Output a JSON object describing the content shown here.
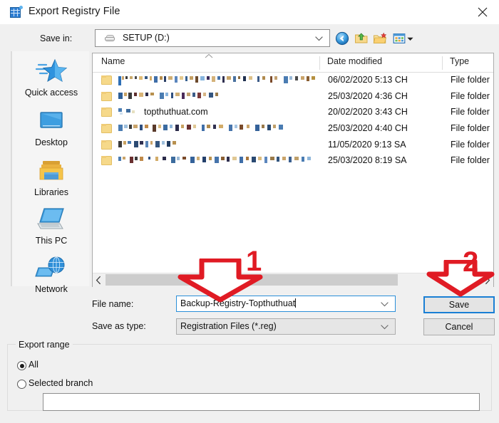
{
  "window": {
    "title": "Export Registry File",
    "icon": "registry-editor-icon",
    "close_label": "✕"
  },
  "toolbar": {
    "save_in_label": "Save in:",
    "save_in_value": "SETUP (D:)",
    "buttons": [
      {
        "name": "back-button",
        "icon": "back-arrow-icon",
        "label": "Back"
      },
      {
        "name": "up-one-level-button",
        "icon": "up-folder-icon",
        "label": "Up One Level"
      },
      {
        "name": "create-new-folder-button",
        "icon": "new-folder-icon",
        "label": "Create New Folder"
      },
      {
        "name": "views-button",
        "icon": "views-icon",
        "label": "Views"
      }
    ]
  },
  "places": {
    "items": [
      {
        "label": "Quick access",
        "icon": "quick-access-star-icon"
      },
      {
        "label": "Desktop",
        "icon": "desktop-monitor-icon"
      },
      {
        "label": "Libraries",
        "icon": "libraries-folder-icon"
      },
      {
        "label": "This PC",
        "icon": "this-pc-computer-icon"
      },
      {
        "label": "Network",
        "icon": "network-globe-icon"
      }
    ]
  },
  "file_list": {
    "columns": [
      "Name",
      "Date modified",
      "Type"
    ],
    "sort_column": "Name",
    "sort_direction": "ascending",
    "rows": [
      {
        "name": "",
        "name_redacted": true,
        "date_modified": "06/02/2020 5:13 CH",
        "type": "File folder"
      },
      {
        "name": "",
        "name_redacted": true,
        "date_modified": "25/03/2020 4:36 CH",
        "type": "File folder"
      },
      {
        "name": "topthuthuat.com",
        "name_redacted": false,
        "date_modified": "20/02/2020 3:43 CH",
        "type": "File folder"
      },
      {
        "name": "",
        "name_redacted": true,
        "date_modified": "25/03/2020 4:40 CH",
        "type": "File folder"
      },
      {
        "name": "",
        "name_redacted": true,
        "date_modified": "11/05/2020 9:13 SA",
        "type": "File folder"
      },
      {
        "name": "",
        "name_redacted": true,
        "date_modified": "25/03/2020 8:19 SA",
        "type": "File folder"
      }
    ]
  },
  "form": {
    "file_name_label": "File name:",
    "file_name_value": "Backup-Registry-Topthuthuat",
    "save_as_type_label": "Save as type:",
    "save_as_type_value": "Registration Files (*.reg)",
    "save_button": "Save",
    "cancel_button": "Cancel"
  },
  "export_range": {
    "group_title": "Export range",
    "options": [
      {
        "label": "All",
        "selected": true
      },
      {
        "label": "Selected branch",
        "selected": false
      }
    ],
    "branch_value": ""
  },
  "annotations": {
    "step_one": "1",
    "step_two": "2"
  },
  "colors": {
    "accent_blue": "#1a7fd4",
    "annotation_red": "#e01b24",
    "dialog_bg": "#f0f0f0",
    "folder_yellow": "#f6d98a"
  }
}
